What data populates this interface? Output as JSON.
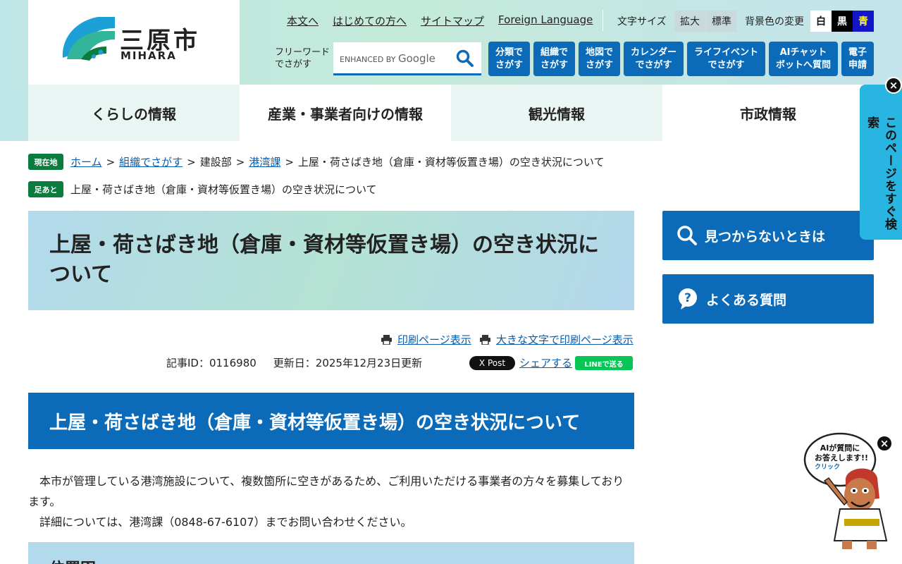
{
  "header": {
    "logo_text": "三原市",
    "logo_sub": "MIHARA",
    "util_links": [
      "本文へ",
      "はじめての方へ",
      "サイトマップ",
      "Foreign Language"
    ],
    "font_size_label": "文字サイズ",
    "font_size_buttons": [
      "拡大",
      "標準"
    ],
    "bg_label": "背景色の変更",
    "bg_buttons": [
      "白",
      "黒",
      "青"
    ],
    "search_label": "フリーワードでさがす",
    "search_placeholder_prefix": "ENHANCED BY",
    "search_placeholder_brand": "Google",
    "quick_buttons": [
      "分類で\nさがす",
      "組織で\nさがす",
      "地図で\nさがす",
      "カレンダー\nでさがす",
      "ライフイベント\nでさがす",
      "AIチャット\nボットへ質問",
      "電子\n申請"
    ]
  },
  "nav": [
    "くらしの情報",
    "産業・事業者向けの情報",
    "観光情報",
    "市政情報"
  ],
  "breadcrumb": {
    "tag": "現在地",
    "items": [
      {
        "label": "ホーム",
        "link": true
      },
      {
        "label": "組織でさがす",
        "link": true
      },
      {
        "label": "建設部",
        "link": false
      },
      {
        "label": "港湾課",
        "link": true
      },
      {
        "label": "上屋・荷さばき地（倉庫・資材等仮置き場）の空き状況について",
        "link": false
      }
    ]
  },
  "footprint": {
    "tag": "足あと",
    "text": "上屋・荷さばき地（倉庫・資材等仮置き場）の空き状況について"
  },
  "main": {
    "title": "上屋・荷さばき地（倉庫・資材等仮置き場）の空き状況について",
    "print_link": "印刷ページ表示",
    "print_large_link": "大きな文字で印刷ページ表示",
    "article_id": "記事ID：0116980",
    "updated": "更新日：2025年12月23日更新",
    "x_post": "X Post",
    "share": "シェアする",
    "line": "LINEで送る",
    "section_title": "上屋・荷さばき地（倉庫・資材等仮置き場）の空き状況について",
    "paragraph1": "本市が管理している港湾施設について、複数箇所に空きがあるため、ご利用いただける事業者の方々を募集しております。",
    "paragraph2": "詳細については、港湾課（0848-67-6107）までお問い合わせください。",
    "sub_heading": "位置図"
  },
  "sidebar": {
    "not_found": "見つからないときは",
    "faq": "よくある質問",
    "side_tab": "このページをすぐ検索"
  },
  "mascot": {
    "bubble_line1": "AIが質問に",
    "bubble_line2": "お答えします!!",
    "bubble_line3": "クリック"
  },
  "colors": {
    "primary": "#0b6bb8",
    "tag_green": "#0a7c3e",
    "side_tab": "#29b5e2"
  }
}
